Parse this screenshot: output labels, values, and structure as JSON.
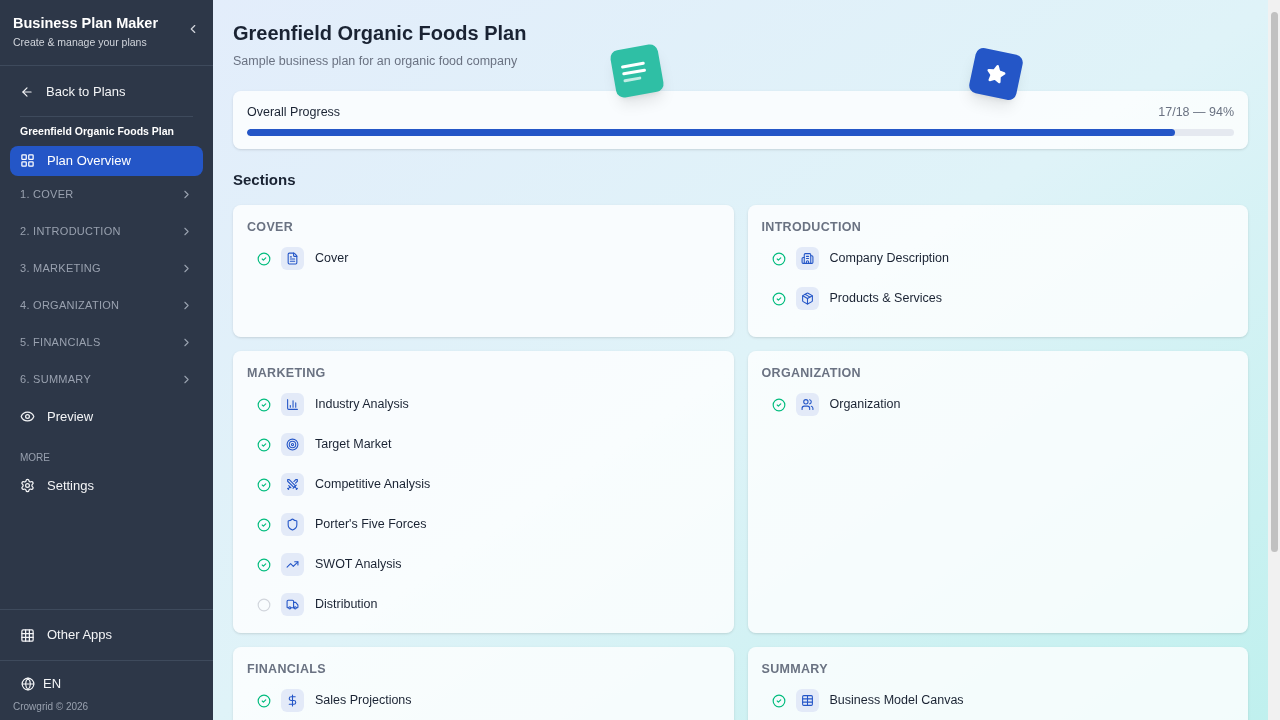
{
  "sidebar": {
    "title": "Business Plan Maker",
    "subtitle": "Create & manage your plans",
    "back": "Back to Plans",
    "plan_name": "Greenfield Organic Foods Plan",
    "items": [
      {
        "label": "Plan Overview",
        "kind": "page",
        "selected": true
      },
      {
        "label": "1. COVER",
        "kind": "section",
        "selected": false,
        "expanded": false
      },
      {
        "label": "2. INTRODUCTION",
        "kind": "section",
        "selected": false,
        "expanded": false
      },
      {
        "label": "3. MARKETING",
        "kind": "section",
        "selected": false,
        "expanded": false
      },
      {
        "label": "4. ORGANIZATION",
        "kind": "section",
        "selected": false,
        "expanded": false
      },
      {
        "label": "5. FINANCIALS",
        "kind": "section",
        "selected": false,
        "expanded": false
      },
      {
        "label": "6. SUMMARY",
        "kind": "section",
        "selected": false,
        "expanded": false
      },
      {
        "label": "Preview",
        "kind": "preview",
        "selected": false
      }
    ],
    "more_heading": "MORE",
    "settings": "Settings",
    "other_apps": "Other Apps",
    "language": "EN",
    "footer": "Crowgrid © 2026"
  },
  "header": {
    "title": "Greenfield Organic Foods Plan",
    "subtitle": "Sample business plan for an organic food company"
  },
  "progress": {
    "label": "Overall Progress",
    "reading": "17/18 — 94%",
    "level": 0.94
  },
  "sections_heading": "Sections",
  "sections": [
    {
      "title": "COVER",
      "items": [
        {
          "label": "Cover",
          "done": true
        }
      ]
    },
    {
      "title": "INTRODUCTION",
      "items": [
        {
          "label": "Company Description",
          "done": true
        },
        {
          "label": "Products & Services",
          "done": true
        }
      ]
    },
    {
      "title": "MARKETING",
      "items": [
        {
          "label": "Industry Analysis",
          "done": true
        },
        {
          "label": "Target Market",
          "done": true
        },
        {
          "label": "Competitive Analysis",
          "done": true
        },
        {
          "label": "Porter's Five Forces",
          "done": true
        },
        {
          "label": "SWOT Analysis",
          "done": true
        },
        {
          "label": "Distribution",
          "done": false
        }
      ]
    },
    {
      "title": "ORGANIZATION",
      "items": [
        {
          "label": "Organization",
          "done": true
        }
      ]
    },
    {
      "title": "FINANCIALS",
      "items": [
        {
          "label": "Sales Projections",
          "done": true
        }
      ]
    },
    {
      "title": "SUMMARY",
      "items": [
        {
          "label": "Business Model Canvas",
          "done": true
        }
      ]
    }
  ]
}
